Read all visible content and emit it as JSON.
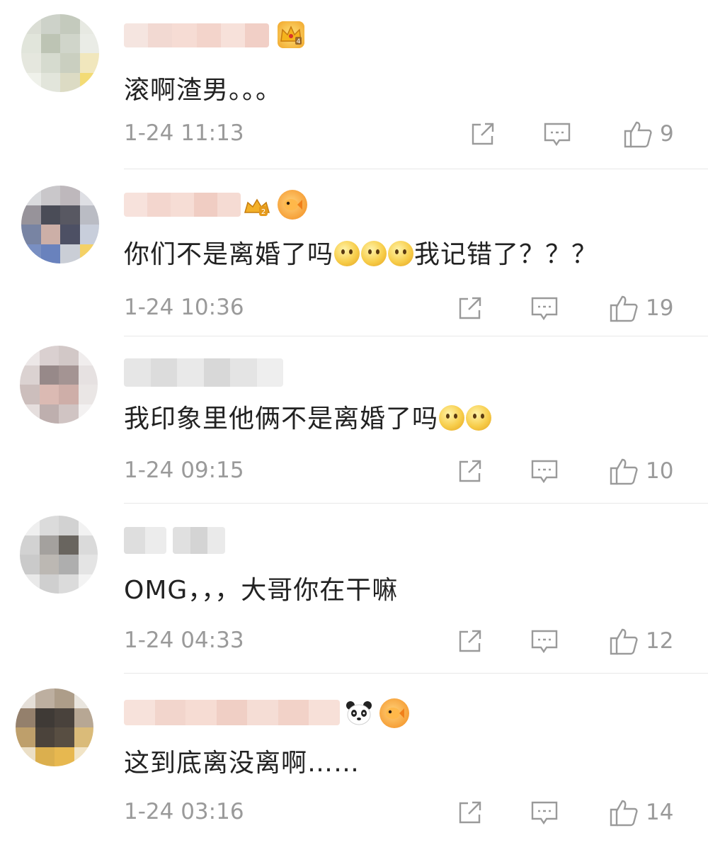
{
  "comments": [
    {
      "text": "滚啊渣男。。。",
      "time": "1-24 11:13",
      "likes": "9",
      "badge_icons": [
        "crown-level-4-icon"
      ],
      "emoji_icons": []
    },
    {
      "text_before": "你们不是离婚了吗",
      "text_after": "我记错了？？？",
      "time": "1-24 10:36",
      "likes": "19",
      "badge_icons": [
        "fan-level-2-icon",
        "goldfish-icon"
      ],
      "emoji_icons": [
        "confused-face-emoji",
        "confused-face-emoji",
        "confused-face-emoji"
      ]
    },
    {
      "text_before": "我印象里他俩不是离婚了吗",
      "time": "1-24 09:15",
      "likes": "10",
      "badge_icons": [],
      "emoji_icons": [
        "thinking-face-emoji",
        "thinking-face-emoji"
      ]
    },
    {
      "text": "OMG，，，大哥你在干嘛",
      "time": "1-24 04:33",
      "likes": "12",
      "badge_icons": [],
      "emoji_icons": []
    },
    {
      "text": "这到底离没离啊……",
      "time": "1-24 03:16",
      "likes": "14",
      "badge_icons": [
        "panda-icon",
        "goldfish-icon"
      ],
      "emoji_icons": []
    }
  ],
  "actions": {
    "share_icon": "share-icon",
    "reply_icon": "comment-icon",
    "like_icon": "thumbs-up-icon"
  },
  "colors": {
    "text": "#222222",
    "meta": "#9a9a9a",
    "divider": "#e8e8e8"
  }
}
